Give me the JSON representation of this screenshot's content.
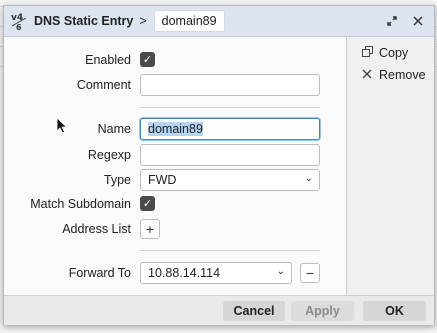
{
  "window": {
    "title": "DNS Static Entry",
    "separator": ">",
    "entry_name": "domain89",
    "logo_icon": "mikrotik-logo-icon",
    "restore_icon": "restore-icon",
    "close_icon": "close-icon"
  },
  "form": {
    "enabled": {
      "label": "Enabled",
      "checked": true
    },
    "comment": {
      "label": "Comment",
      "value": ""
    },
    "name": {
      "label": "Name",
      "value": "domain89"
    },
    "regexp": {
      "label": "Regexp",
      "value": ""
    },
    "type": {
      "label": "Type",
      "value": "FWD"
    },
    "match_subdomain": {
      "label": "Match Subdomain",
      "checked": true
    },
    "address_list": {
      "label": "Address List",
      "add_symbol": "+"
    },
    "forward_to": {
      "label": "Forward To",
      "value": "10.88.14.114",
      "remove_symbol": "−"
    }
  },
  "side_actions": [
    {
      "label": "Copy",
      "icon": "copy-icon"
    },
    {
      "label": "Remove",
      "icon": "remove-icon"
    }
  ],
  "footer": {
    "cancel": "Cancel",
    "apply": "Apply",
    "ok": "OK"
  },
  "colors": {
    "titlebar": "#dbe4f0",
    "focus": "#3f88c5",
    "selection": "#b5d3f3"
  }
}
